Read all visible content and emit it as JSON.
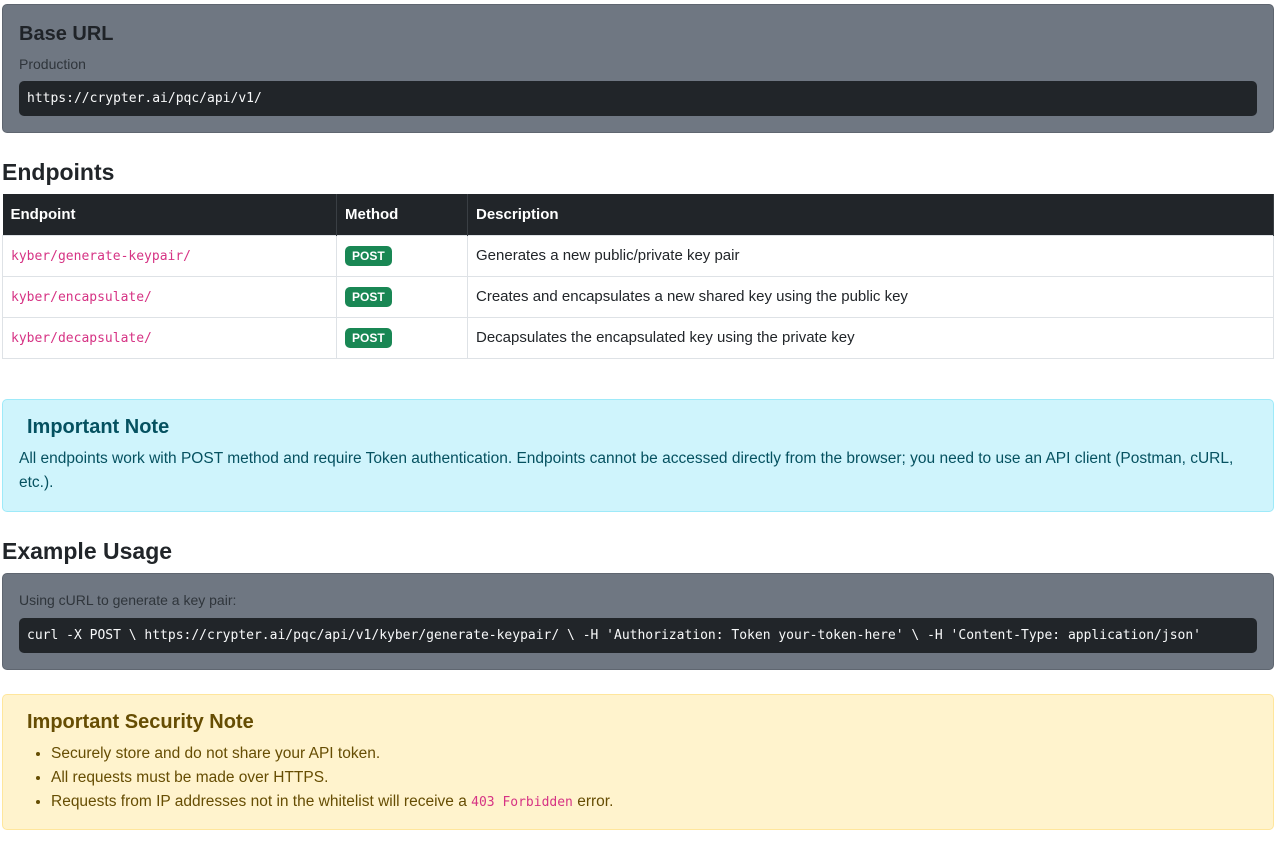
{
  "base_url": {
    "title": "Base URL",
    "env_label": "Production",
    "url": "https://crypter.ai/pqc/api/v1/"
  },
  "endpoints": {
    "heading": "Endpoints",
    "columns": [
      "Endpoint",
      "Method",
      "Description"
    ],
    "rows": [
      {
        "endpoint": "kyber/generate-keypair/",
        "method": "POST",
        "description": "Generates a new public/private key pair"
      },
      {
        "endpoint": "kyber/encapsulate/",
        "method": "POST",
        "description": "Creates and encapsulates a new shared key using the public key"
      },
      {
        "endpoint": "kyber/decapsulate/",
        "method": "POST",
        "description": "Decapsulates the encapsulated key using the private key"
      }
    ]
  },
  "note": {
    "title": "Important Note",
    "text": "All endpoints work with POST method and require Token authentication. Endpoints cannot be accessed directly from the browser; you need to use an API client (Postman, cURL, etc.)."
  },
  "example": {
    "heading": "Example Usage",
    "caption": "Using cURL to generate a key pair:",
    "code": "curl -X POST \\ https://crypter.ai/pqc/api/v1/kyber/generate-keypair/ \\ -H 'Authorization: Token your-token-here' \\ -H 'Content-Type: application/json'"
  },
  "security": {
    "title": "Important Security Note",
    "items": [
      "Securely store and do not share your API token.",
      "All requests must be made over HTTPS."
    ],
    "ip_item_prefix": "Requests from IP addresses not in the whitelist will receive a",
    "ip_item_code": "403 Forbidden",
    "ip_item_suffix": "error."
  },
  "colors": {
    "badge_post": "#198754",
    "code_pink": "#d63384",
    "info_bg": "#cff4fc",
    "warn_bg": "#fff3cd",
    "gray_card": "#6f7782",
    "dark": "#212529"
  }
}
